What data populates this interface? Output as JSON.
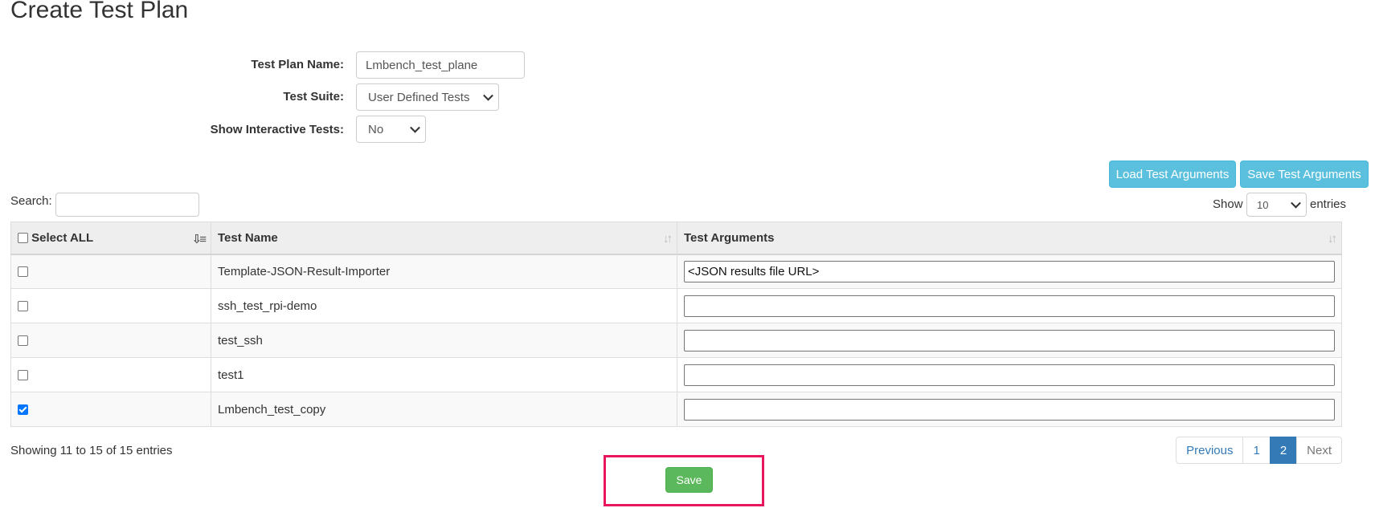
{
  "page": {
    "title": "Create Test Plan"
  },
  "form": {
    "plan_name_label": "Test Plan Name:",
    "plan_name_value": "Lmbench_test_plane",
    "suite_label": "Test Suite:",
    "suite_value": "User Defined Tests",
    "interactive_label": "Show Interactive Tests:",
    "interactive_value": "No"
  },
  "toolbar": {
    "load_label": "Load Test Arguments",
    "save_args_label": "Save Test Arguments"
  },
  "search": {
    "label": "Search:",
    "value": ""
  },
  "length": {
    "show_label": "Show",
    "value": "10",
    "entries_label": "entries"
  },
  "table": {
    "headers": {
      "select_all": "Select ALL",
      "name": "Test Name",
      "args": "Test Arguments"
    },
    "rows": [
      {
        "checked": false,
        "name": "Template-JSON-Result-Importer",
        "args": "<JSON results file URL>"
      },
      {
        "checked": false,
        "name": "ssh_test_rpi-demo",
        "args": ""
      },
      {
        "checked": false,
        "name": "test_ssh",
        "args": ""
      },
      {
        "checked": false,
        "name": "test1",
        "args": ""
      },
      {
        "checked": true,
        "name": "Lmbench_test_copy",
        "args": ""
      }
    ]
  },
  "info": {
    "text": "Showing 11 to 15 of 15 entries"
  },
  "pagination": {
    "previous": "Previous",
    "page1": "1",
    "page2": "2",
    "next": "Next",
    "current_page": 2
  },
  "actions": {
    "save_label": "Save"
  },
  "colors": {
    "info_button": "#5bc0de",
    "save_button": "#5cb85c",
    "highlight": "#e8175d",
    "active_page": "#337ab7"
  }
}
